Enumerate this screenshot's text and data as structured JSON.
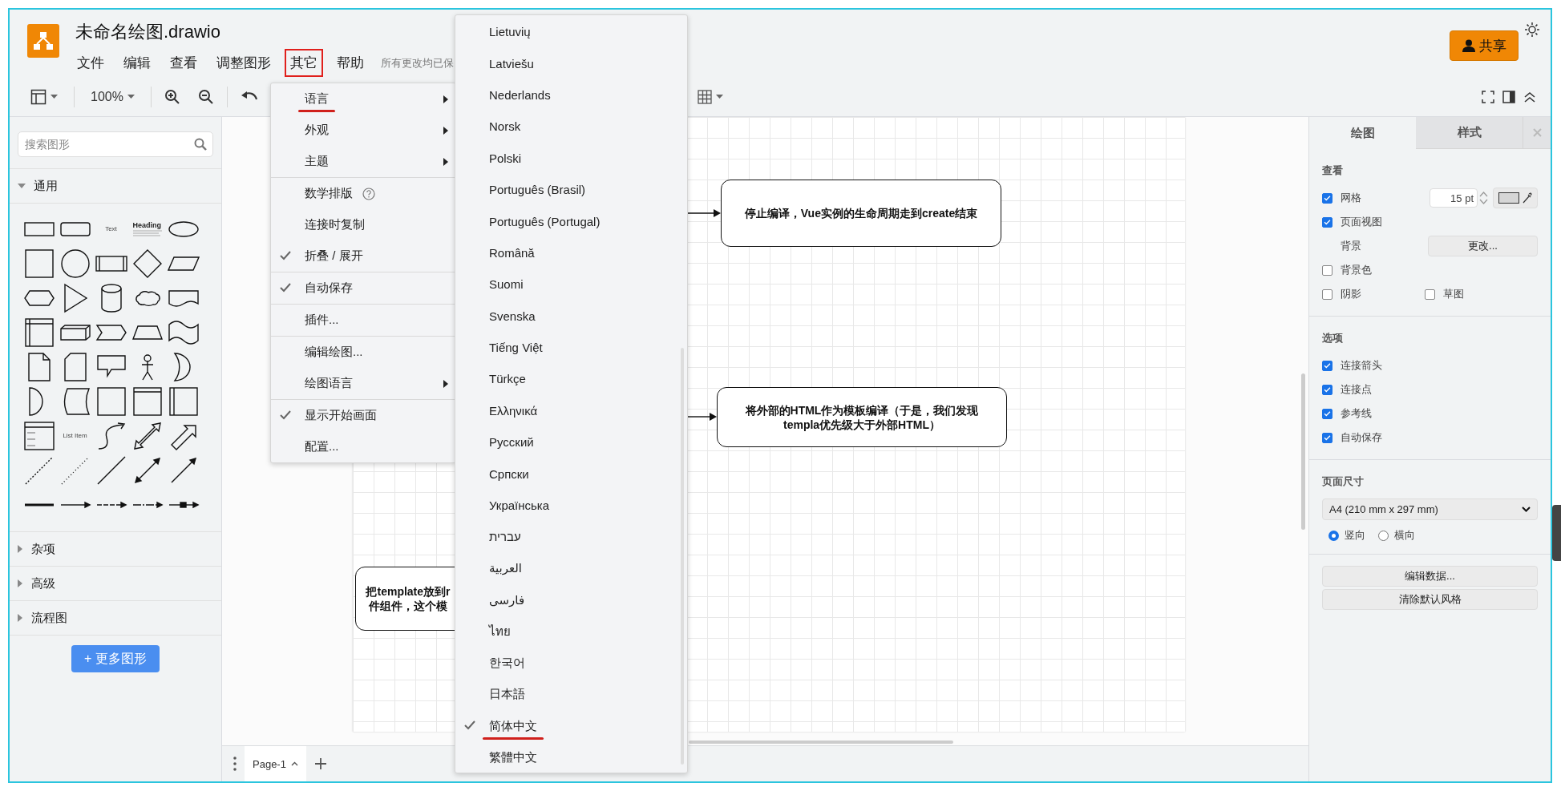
{
  "app": {
    "title": "未命名绘图.drawio",
    "menus": [
      {
        "label": "文件",
        "annotated": false
      },
      {
        "label": "编辑",
        "annotated": false
      },
      {
        "label": "查看",
        "annotated": false
      },
      {
        "label": "调整图形",
        "annotated": false
      },
      {
        "label": "其它",
        "annotated": true
      },
      {
        "label": "帮助",
        "annotated": false
      }
    ],
    "status": "所有更改均已保",
    "share_button": "共享"
  },
  "toolbar": {
    "zoom": "100%"
  },
  "sidebar": {
    "search_placeholder": "搜索图形",
    "sections": [
      {
        "label": "通用",
        "expanded": true
      },
      {
        "label": "杂项",
        "expanded": false
      },
      {
        "label": "高级",
        "expanded": false
      },
      {
        "label": "流程图",
        "expanded": false
      }
    ],
    "palette_texts": [
      "Text",
      "Heading",
      "List Item"
    ],
    "more_button": "+ 更多图形"
  },
  "diagram": {
    "nodes": [
      {
        "lines": [
          "停止编译，Vue实例的生命周期走到create结束"
        ]
      },
      {
        "lines": [
          "将外部的HTML作为模板编译（于是，我们发现",
          "templa优先级大于外部HTML）"
        ]
      },
      {
        "lines": [
          "把template放到r",
          "件组件，这个模"
        ]
      }
    ]
  },
  "page_tabs": [
    {
      "label": "Page-1",
      "selected": true
    }
  ],
  "format_panel": {
    "tabs": [
      {
        "label": "绘图",
        "selected": true
      },
      {
        "label": "样式",
        "selected": false
      }
    ],
    "view": {
      "title": "查看",
      "grid": {
        "label": "网格",
        "checked": true,
        "value": "15 pt"
      },
      "page_view": {
        "label": "页面视图",
        "checked": true
      },
      "background": {
        "label": "背景",
        "button": "更改..."
      },
      "background_color": {
        "label": "背景色",
        "checked": false
      },
      "shadow": {
        "label": "阴影",
        "checked": false
      },
      "sketch": {
        "label": "草图",
        "checked": false
      }
    },
    "options": {
      "title": "选项",
      "items": [
        {
          "label": "连接箭头",
          "checked": true
        },
        {
          "label": "连接点",
          "checked": true
        },
        {
          "label": "参考线",
          "checked": true
        },
        {
          "label": "自动保存",
          "checked": true
        }
      ]
    },
    "page_size": {
      "title": "页面尺寸",
      "value": "A4 (210 mm x 297 mm)",
      "orientations": [
        {
          "label": "竖向",
          "selected": true
        },
        {
          "label": "横向",
          "selected": false
        }
      ]
    },
    "buttons": [
      "编辑数据...",
      "清除默认风格"
    ]
  },
  "other_menu": {
    "groups": [
      [
        {
          "label": "语言",
          "kind": "submenu",
          "checked": false,
          "annotated": true
        },
        {
          "label": "外观",
          "kind": "submenu",
          "checked": false,
          "annotated": false
        },
        {
          "label": "主题",
          "kind": "submenu",
          "checked": false,
          "annotated": false
        }
      ],
      [
        {
          "label": "数学排版",
          "kind": "help",
          "checked": false,
          "annotated": false
        },
        {
          "label": "连接时复制",
          "kind": "plain",
          "checked": false,
          "annotated": false
        },
        {
          "label": "折叠 / 展开",
          "kind": "plain",
          "checked": true,
          "annotated": false
        }
      ],
      [
        {
          "label": "自动保存",
          "kind": "plain",
          "checked": true,
          "annotated": false
        }
      ],
      [
        {
          "label": "插件...",
          "kind": "plain",
          "checked": false,
          "annotated": false
        }
      ],
      [
        {
          "label": "编辑绘图...",
          "kind": "plain",
          "checked": false,
          "annotated": false
        },
        {
          "label": "绘图语言",
          "kind": "submenu",
          "checked": false,
          "annotated": false
        }
      ],
      [
        {
          "label": "显示开始画面",
          "kind": "plain",
          "checked": true,
          "annotated": false
        },
        {
          "label": "配置...",
          "kind": "plain",
          "checked": false,
          "annotated": false
        }
      ]
    ]
  },
  "language_menu": {
    "items": [
      {
        "label": "Lietuvių",
        "selected": false,
        "annotated": false
      },
      {
        "label": "Latviešu",
        "selected": false,
        "annotated": false
      },
      {
        "label": "Nederlands",
        "selected": false,
        "annotated": false
      },
      {
        "label": "Norsk",
        "selected": false,
        "annotated": false
      },
      {
        "label": "Polski",
        "selected": false,
        "annotated": false
      },
      {
        "label": "Português (Brasil)",
        "selected": false,
        "annotated": false
      },
      {
        "label": "Português (Portugal)",
        "selected": false,
        "annotated": false
      },
      {
        "label": "Română",
        "selected": false,
        "annotated": false
      },
      {
        "label": "Suomi",
        "selected": false,
        "annotated": false
      },
      {
        "label": "Svenska",
        "selected": false,
        "annotated": false
      },
      {
        "label": "Tiếng Việt",
        "selected": false,
        "annotated": false
      },
      {
        "label": "Türkçe",
        "selected": false,
        "annotated": false
      },
      {
        "label": "Ελληνικά",
        "selected": false,
        "annotated": false
      },
      {
        "label": "Русский",
        "selected": false,
        "annotated": false
      },
      {
        "label": "Српски",
        "selected": false,
        "annotated": false
      },
      {
        "label": "Українська",
        "selected": false,
        "annotated": false
      },
      {
        "label": "עברית",
        "selected": false,
        "annotated": false
      },
      {
        "label": "العربية",
        "selected": false,
        "annotated": false
      },
      {
        "label": "فارسی",
        "selected": false,
        "annotated": false
      },
      {
        "label": "ไทย",
        "selected": false,
        "annotated": false
      },
      {
        "label": "한국어",
        "selected": false,
        "annotated": false
      },
      {
        "label": "日本語",
        "selected": false,
        "annotated": false
      },
      {
        "label": "简体中文",
        "selected": true,
        "annotated": true
      },
      {
        "label": "繁體中文",
        "selected": false,
        "annotated": false
      }
    ]
  }
}
